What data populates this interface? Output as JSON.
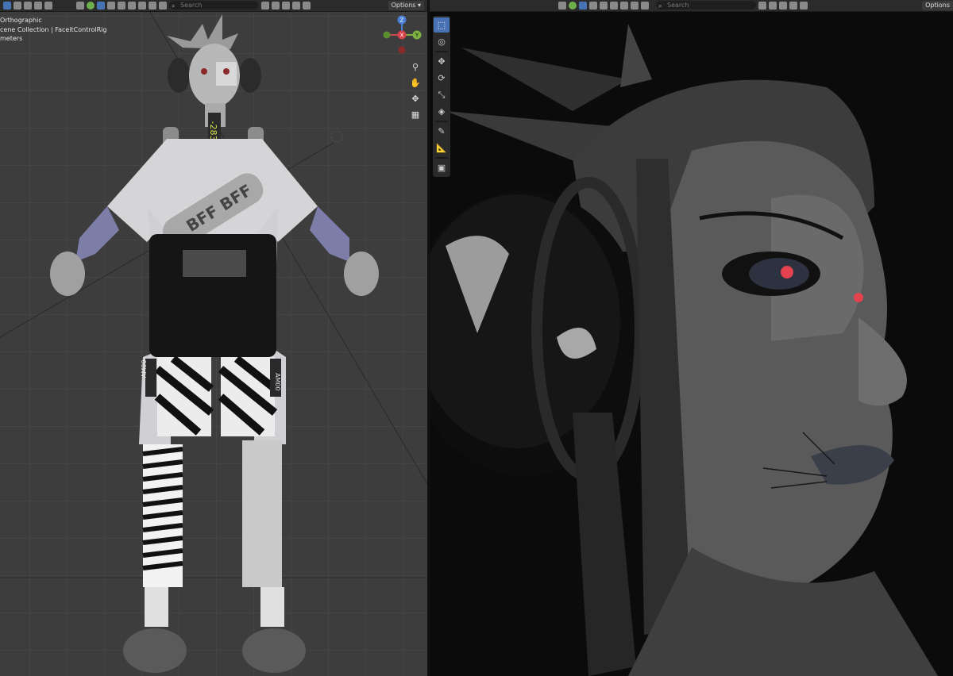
{
  "left_viewport": {
    "header": {
      "search_placeholder": "Search",
      "options_label": "Options"
    },
    "overlay": {
      "view_name": "Orthographic",
      "collection": "cene Collection | FaceitControlRig",
      "units": "meters"
    },
    "gizmo": {
      "x_label": "X",
      "y_label": "Y",
      "z_label": "Z"
    },
    "model_labels": {
      "neck_tag": "-283",
      "pouch_text_1": "BFF",
      "pouch_text_2": "BFF",
      "thigh_left": "AM00",
      "thigh_right": "AM00"
    }
  },
  "right_viewport": {
    "header": {
      "search_placeholder": "Search",
      "options_label": "Options"
    },
    "toolbar": [
      "select-box",
      "cursor",
      "move",
      "rotate",
      "scale",
      "transform",
      "annotate",
      "measure",
      "add-cube"
    ]
  },
  "colors": {
    "accent": "#4772b3",
    "viewport_grid_bg": "#3d3d3d",
    "render_bg": "#0b0b0b"
  }
}
